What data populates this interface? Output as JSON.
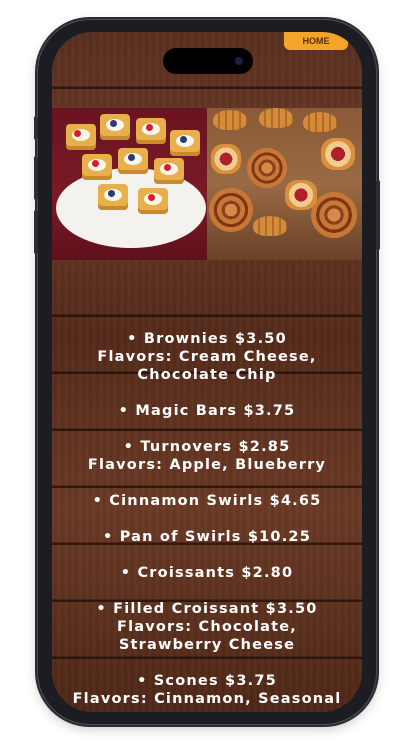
{
  "header": {
    "home_label": "HOME"
  },
  "menu": {
    "items": [
      {
        "line1": "• Brownies  $3.50",
        "line2": "Flavors: Cream Cheese,",
        "line3": "Chocolate Chip"
      },
      {
        "line1": "• Magic Bars  $3.75",
        "line2": "",
        "line3": ""
      },
      {
        "line1": "• Turnovers  $2.85",
        "line2": "Flavors: Apple, Blueberry",
        "line3": ""
      },
      {
        "line1": "• Cinnamon Swirls  $4.65",
        "line2": "",
        "line3": ""
      },
      {
        "line1": "• Pan of Swirls  $10.25",
        "line2": "",
        "line3": ""
      },
      {
        "line1": "• Croissants  $2.80",
        "line2": "",
        "line3": ""
      },
      {
        "line1": "• Filled Croissant  $3.50",
        "line2": "Flavors: Chocolate,",
        "line3": "Strawberry Cheese"
      },
      {
        "line1": "• Scones  $3.75",
        "line2": "Flavors: Cinnamon, Seasonal",
        "line3": ""
      }
    ]
  },
  "colors": {
    "wood": "#5a2f1f",
    "text": "#ffffff",
    "accent": "#f2a52a",
    "frame": "#1b1d22"
  }
}
